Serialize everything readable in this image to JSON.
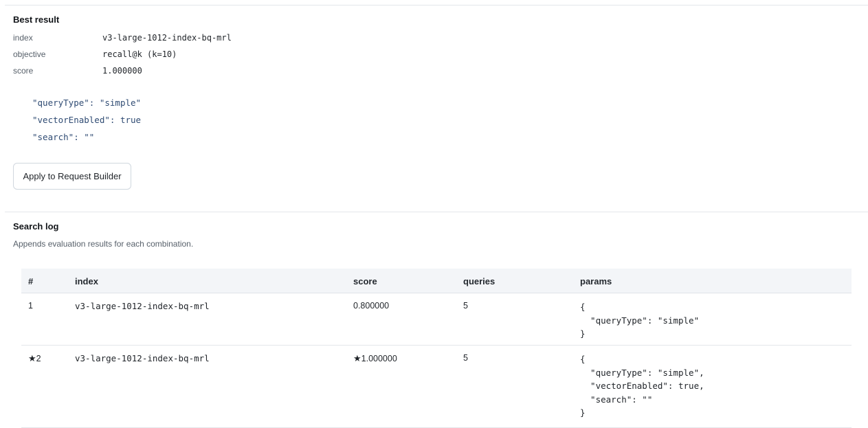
{
  "best_result": {
    "title": "Best result",
    "fields": [
      {
        "key": "index",
        "value": "v3-large-1012-index-bq-mrl"
      },
      {
        "key": "objective",
        "value": "recall@k (k=10)"
      },
      {
        "key": "score",
        "value": "1.000000"
      }
    ],
    "params": [
      {
        "key": "\"queryType\"",
        "value": "\"simple\""
      },
      {
        "key": "\"vectorEnabled\"",
        "value": "true"
      },
      {
        "key": "\"search\"",
        "value": "\"\""
      }
    ],
    "apply_button": "Apply to Request Builder"
  },
  "search_log": {
    "title": "Search log",
    "subtitle": "Appends evaluation results for each combination.",
    "columns": [
      "#",
      "index",
      "score",
      "queries",
      "params"
    ],
    "rows": [
      {
        "num": "1",
        "starred": false,
        "index": "v3-large-1012-index-bq-mrl",
        "score": "0.800000",
        "queries": "5",
        "params": "{\n  \"queryType\": \"simple\"\n}"
      },
      {
        "num": "2",
        "starred": true,
        "index": "v3-large-1012-index-bq-mrl",
        "score": "1.000000",
        "queries": "5",
        "params": "{\n  \"queryType\": \"simple\",\n  \"vectorEnabled\": true,\n  \"search\": \"\"\n}"
      }
    ],
    "star_glyph": "★"
  }
}
